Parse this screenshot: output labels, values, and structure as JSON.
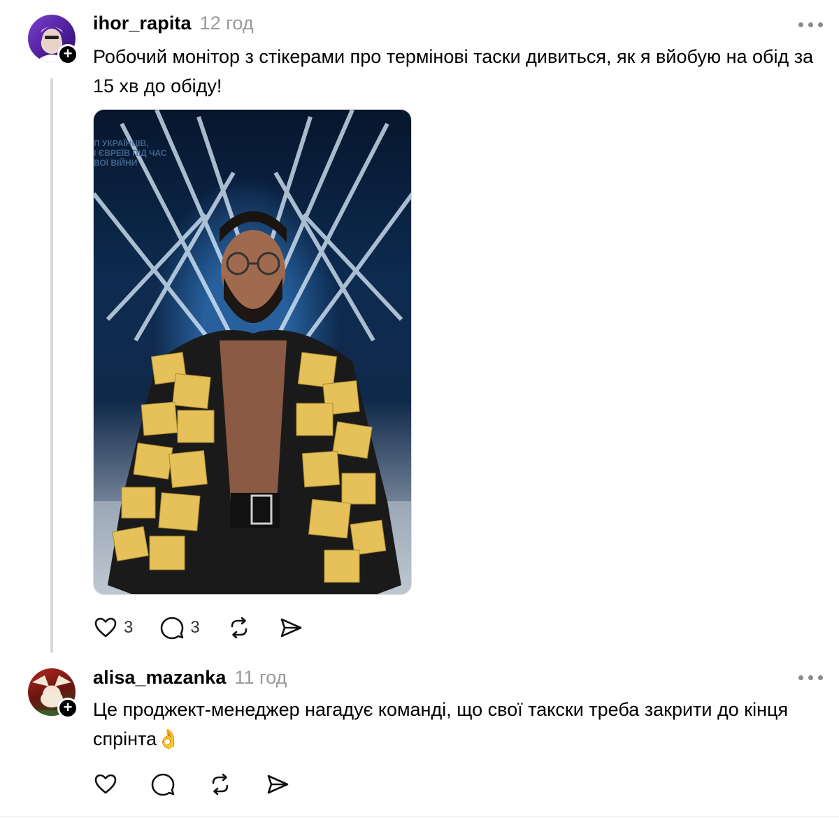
{
  "posts": [
    {
      "username": "ihor_rapita",
      "time": "12 год",
      "text": "Робочий монітор з стікерами про термінові таски дивиться, як я вйобую на обід за 15 хв до обіду!",
      "media_overlay_text": [
        "П УКРАЇНЦІВ,",
        "І ЄВРЕЇВ ПІД ЧАС",
        "ВОЇ ВІЙНИ"
      ],
      "likes": "3",
      "replies": "3"
    },
    {
      "username": "alisa_mazanka",
      "time": "11 год",
      "text": "Це проджект-менеджер нагадує команді, що свої такски треба закрити до кінця спрінта👌",
      "likes": "",
      "replies": ""
    }
  ],
  "icons": {
    "follow": "+",
    "like": "heart-icon",
    "reply": "comment-icon",
    "repost": "repost-icon",
    "share": "send-icon",
    "more": "more-dots-icon"
  }
}
